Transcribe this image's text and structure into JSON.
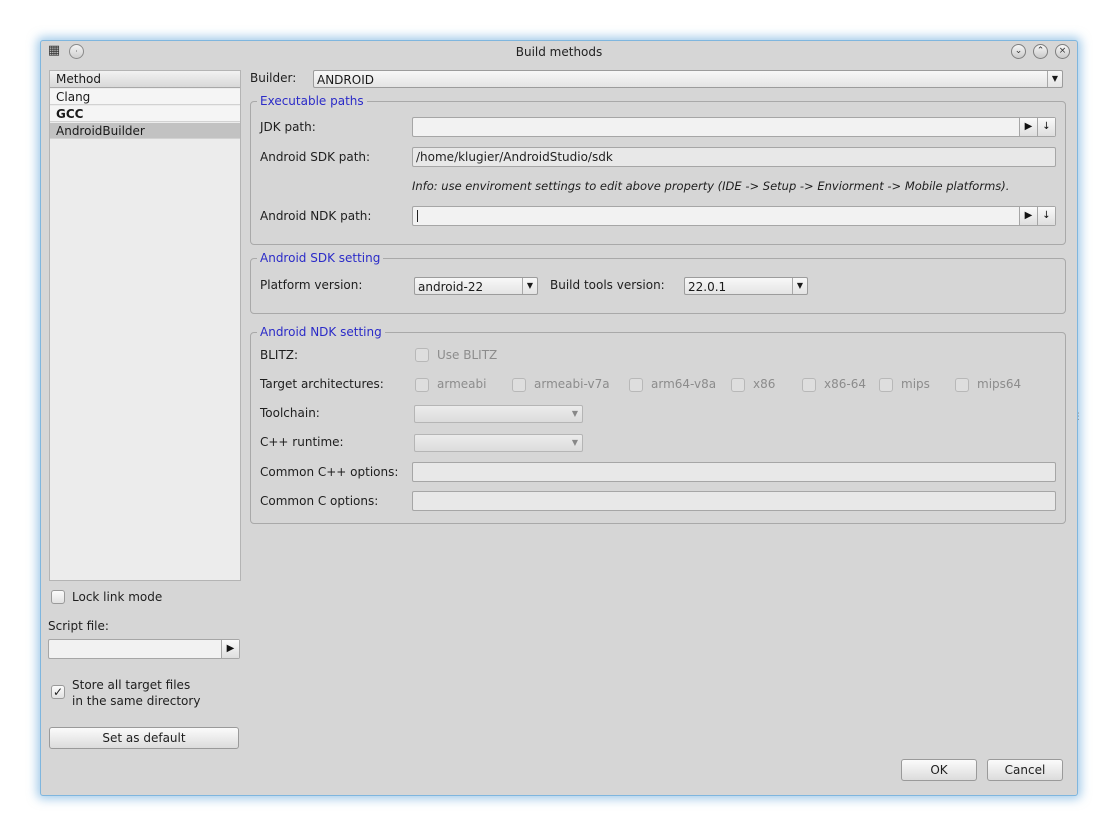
{
  "window": {
    "title": "Build methods"
  },
  "methods": {
    "header": "Method",
    "items": [
      {
        "label": "Clang",
        "selected": false,
        "bold": false
      },
      {
        "label": "GCC",
        "selected": false,
        "bold": true
      },
      {
        "label": "AndroidBuilder",
        "selected": true,
        "bold": false
      }
    ]
  },
  "left": {
    "lock_link_label": "Lock link mode",
    "lock_link_checked": false,
    "script_file_label": "Script file:",
    "script_file_value": "",
    "store_files_line1": "Store all target files",
    "store_files_line2": "in the same directory",
    "store_files_checked": true,
    "set_default_label": "Set as default"
  },
  "builder": {
    "label": "Builder:",
    "value": "ANDROID"
  },
  "executable_paths": {
    "title": "Executable paths",
    "jdk_label": "JDK path:",
    "jdk_value": "",
    "sdk_label": "Android SDK path:",
    "sdk_value": "/home/klugier/AndroidStudio/sdk",
    "info": "Info: use enviroment settings to edit above property (IDE -> Setup -> Enviorment -> Mobile platforms).",
    "ndk_label": "Android NDK path:",
    "ndk_value": ""
  },
  "sdk_setting": {
    "title": "Android SDK setting",
    "platform_label": "Platform version:",
    "platform_value": "android-22",
    "build_tools_label": "Build tools version:",
    "build_tools_value": "22.0.1"
  },
  "ndk_setting": {
    "title": "Android NDK setting",
    "blitz_label": "BLITZ:",
    "use_blitz_label": "Use BLITZ",
    "target_arch_label": "Target architectures:",
    "architectures": [
      "armeabi",
      "armeabi-v7a",
      "arm64-v8a",
      "x86",
      "x86-64",
      "mips",
      "mips64"
    ],
    "toolchain_label": "Toolchain:",
    "toolchain_value": "",
    "cpp_runtime_label": "C++ runtime:",
    "cpp_runtime_value": "",
    "common_cpp_label": "Common C++ options:",
    "common_cpp_value": "",
    "common_c_label": "Common C options:",
    "common_c_value": ""
  },
  "footer": {
    "ok_label": "OK",
    "cancel_label": "Cancel"
  },
  "icons": {
    "app": "app-icon",
    "menu": "window-menu-icon",
    "minimize": "minimize-icon",
    "maximize": "maximize-icon",
    "close": "close-icon",
    "browse": "browse-arrow-icon",
    "download": "download-arrow-icon",
    "combo_arrow": "chevron-down-icon",
    "check": "check-icon"
  },
  "colors": {
    "window_border": "#7fb6de",
    "group_title": "#2b2bc8",
    "selection": "#c2c2c2",
    "dialog_bg": "#d6d6d6"
  }
}
